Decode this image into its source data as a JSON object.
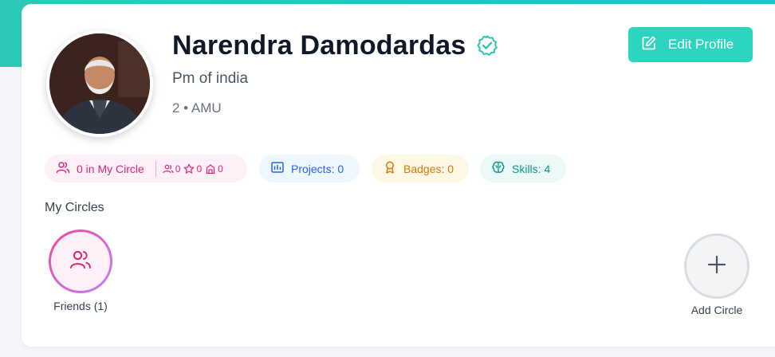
{
  "profile": {
    "name": "Narendra Damodardas",
    "title": "Pm of india",
    "meta": "2 • AMU",
    "verified": true
  },
  "actions": {
    "edit_profile_label": "Edit Profile"
  },
  "stats": {
    "circle_label": "0 in My Circle",
    "circle_people": "0",
    "circle_stars": "0",
    "circle_orgs": "0",
    "projects_label": "Projects: 0",
    "badges_label": "Badges: 0",
    "skills_label": "Skills: 4"
  },
  "circles": {
    "section_title": "My Circles",
    "items": [
      {
        "label": "Friends (1)"
      }
    ],
    "add_label": "Add Circle"
  },
  "colors": {
    "accent": "#2dd4bf",
    "circle_pink": "#db2777",
    "projects_blue": "#2563eb",
    "badges_amber": "#d97706",
    "skills_teal": "#0d9488"
  },
  "icons": {
    "verified": "check-badge-icon",
    "edit": "edit-icon",
    "users": "users-icon",
    "star": "star-icon",
    "building": "building-icon",
    "projects": "chart-board-icon",
    "badges": "award-icon",
    "skills": "brain-icon",
    "add": "plus-icon"
  }
}
